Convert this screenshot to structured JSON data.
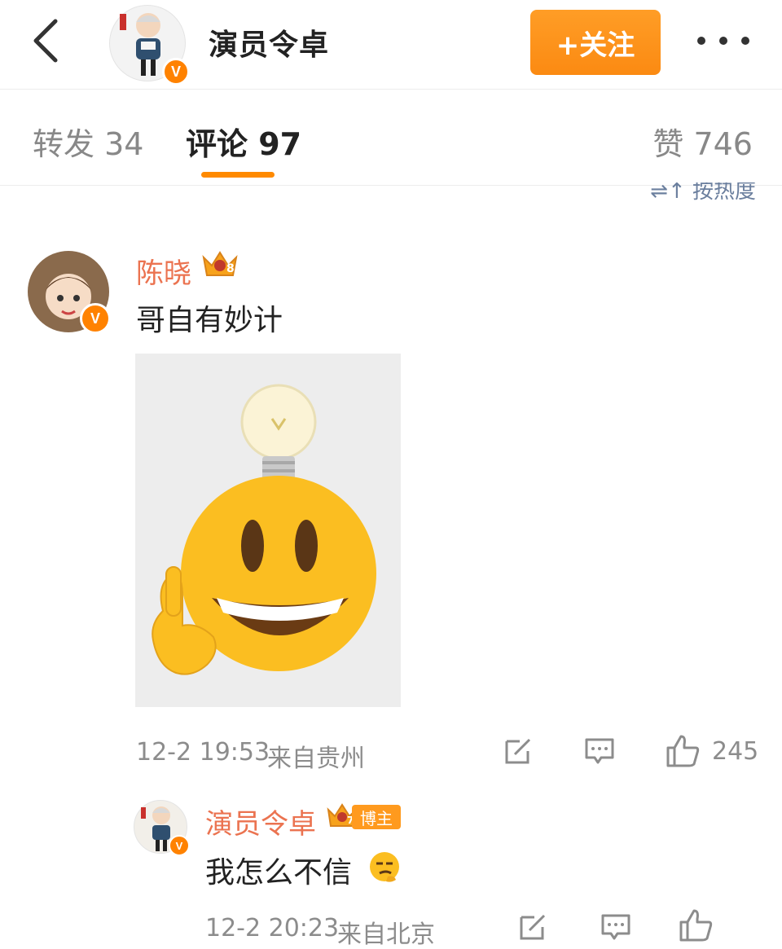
{
  "header": {
    "title": "演员令卓",
    "follow_label": "+关注",
    "verified_badge": "V"
  },
  "tabs": [
    {
      "label": "转发 34"
    },
    {
      "label": "评论 97"
    },
    {
      "label": "赞 746"
    }
  ],
  "sort_label": "⇌↑ 按热度",
  "comment": {
    "author": "陈晓",
    "level": "8",
    "text": "哥自有妙计",
    "time": "12-2 19:53",
    "location": "来自贵州",
    "likes": "245",
    "verified_badge": "V"
  },
  "reply": {
    "author": "演员令卓",
    "level": "7",
    "blogger_tag": "博主",
    "text": "我怎么不信",
    "time": "12-2 20:23",
    "location": "来自北京",
    "verified_badge": "V"
  },
  "colors": {
    "accent": "#ff8a00",
    "username": "#eb7350",
    "meta": "#8c8c8c"
  }
}
